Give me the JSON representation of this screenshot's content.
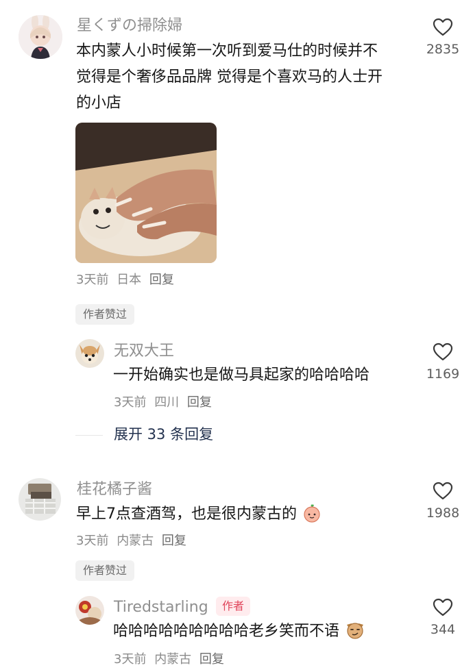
{
  "comments": [
    {
      "username": "星くずの掃除婦",
      "text_lines": [
        "本内蒙人小时候第一次听到爱马仕的时候并不",
        "觉得是个奢侈品品牌 觉得是个喜欢马的人士开",
        "的小店"
      ],
      "time": "3天前",
      "location": "日本",
      "reply_label": "回复",
      "likes": "2835",
      "badge": "作者赞过",
      "has_image": true,
      "reply": {
        "username": "无双大王",
        "text": "一开始确实也是做马具起家的哈哈哈哈",
        "time": "3天前",
        "location": "四川",
        "reply_label": "回复",
        "likes": "1169"
      },
      "expand_label": "展开 33 条回复"
    },
    {
      "username": "桂花橘子酱",
      "text": "早上7点查酒驾，也是很内蒙古的",
      "time": "3天前",
      "location": "内蒙古",
      "reply_label": "回复",
      "likes": "1988",
      "badge": "作者赞过",
      "reply": {
        "username": "Tiredstarling",
        "author_tag": "作者",
        "text": "哈哈哈哈哈哈哈哈哈老乡笑而不语",
        "time": "3天前",
        "location": "内蒙古",
        "reply_label": "回复",
        "likes": "344"
      }
    }
  ],
  "icons": {
    "like": "heart-outline-icon",
    "peach_emoji": "peach-emoji-icon",
    "dog_emoji": "dog-smirk-emoji-icon"
  },
  "colors": {
    "username": "#8f8f8f",
    "body": "#161616",
    "meta": "#8a8a8a",
    "author_tag_bg": "#ffecee",
    "author_tag_text": "#e0445a",
    "expand": "#23324f"
  }
}
